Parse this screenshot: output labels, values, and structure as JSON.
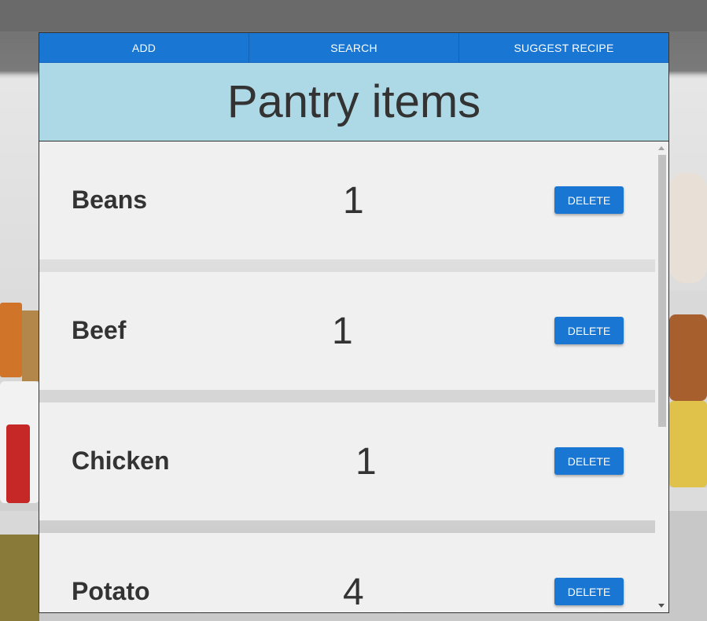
{
  "nav": {
    "add_label": "ADD",
    "search_label": "SEARCH",
    "suggest_label": "SUGGEST RECIPE"
  },
  "header": {
    "title": "Pantry items"
  },
  "items": [
    {
      "name": "Beans",
      "quantity": "1",
      "delete_label": "DELETE"
    },
    {
      "name": "Beef",
      "quantity": "1",
      "delete_label": "DELETE"
    },
    {
      "name": "Chicken",
      "quantity": "1",
      "delete_label": "DELETE"
    },
    {
      "name": "Potato",
      "quantity": "4",
      "delete_label": "DELETE"
    }
  ],
  "colors": {
    "primary": "#1976d2",
    "header_bg": "#add8e6",
    "item_bg": "#f0f0f0",
    "text": "#333333"
  }
}
